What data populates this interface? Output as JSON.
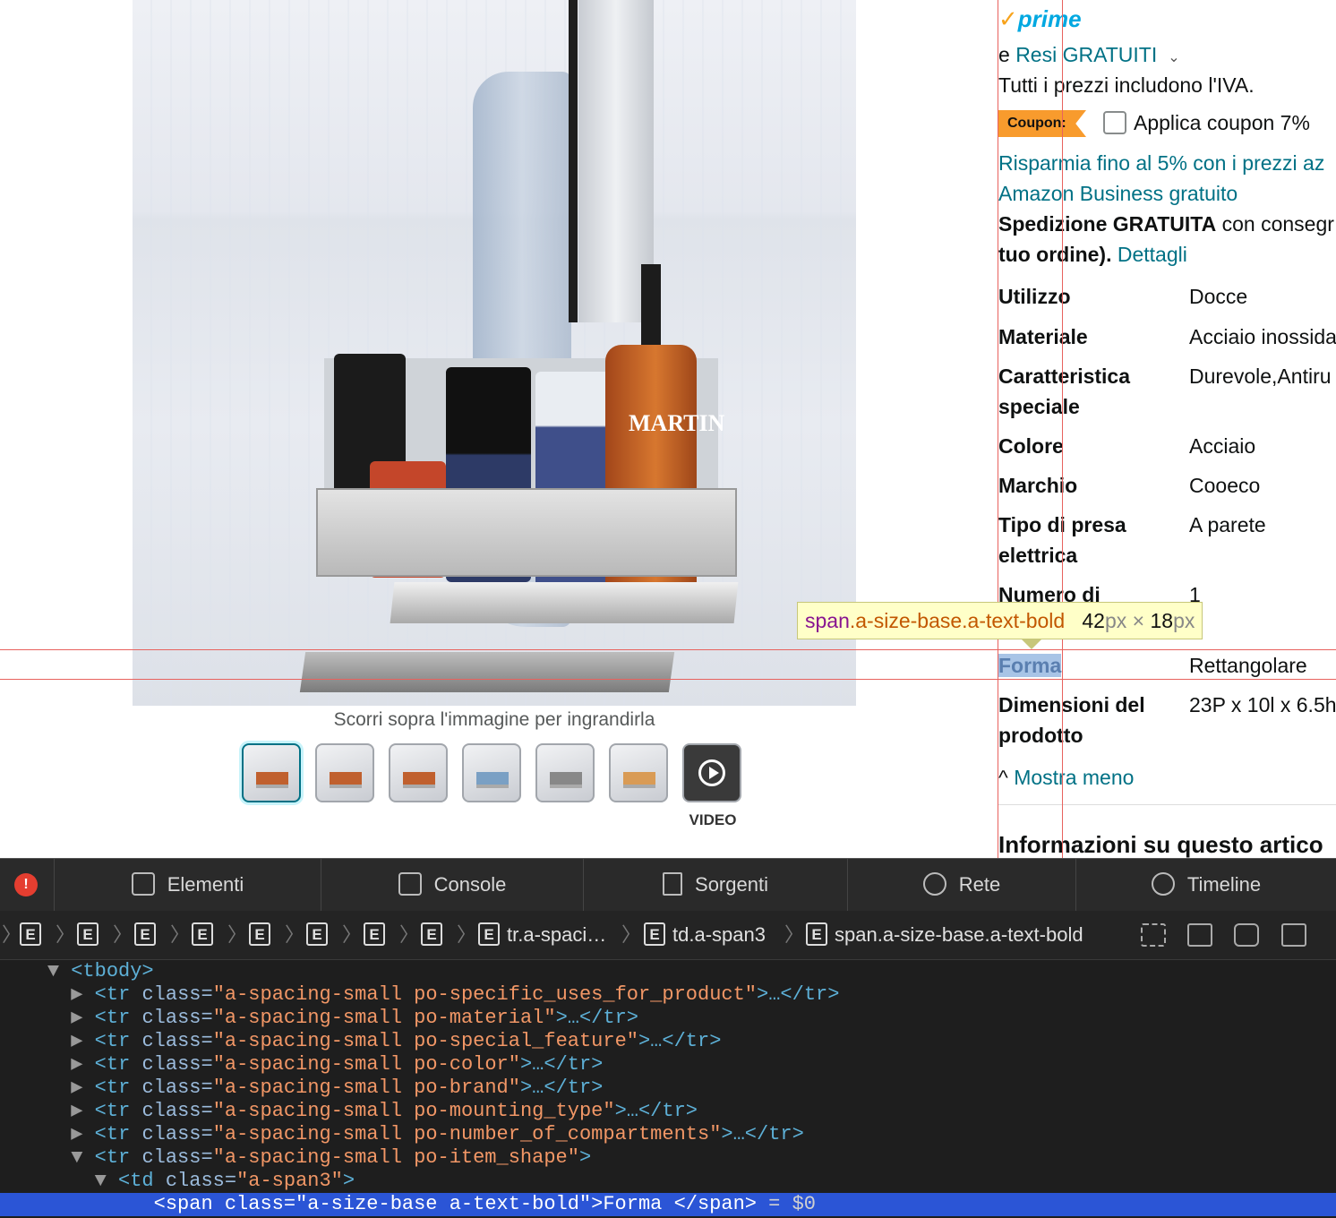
{
  "gallery": {
    "hover_hint": "Scorri sopra l'immagine per ingrandirla",
    "video_label": "VIDEO",
    "image_brand_text": "MARTIN",
    "thumbnail_count": 7
  },
  "offer": {
    "prime_label": "prime",
    "returns_prefix": "e",
    "returns_link": "Resi GRATUITI",
    "vat_note": "Tutti i prezzi includono l'IVA.",
    "coupon_badge": "Coupon:",
    "coupon_text": "Applica coupon 7%",
    "business_line1": "Risparmia fino al 5% con i prezzi az",
    "business_line2": "Amazon Business gratuito",
    "shipping_bold": "Spedizione GRATUITA",
    "shipping_rest": " con consegr",
    "shipping_line2_bold": "tuo ordine).",
    "details_link": "Dettagli"
  },
  "specs": [
    {
      "label": "Utilizzo",
      "value": "Docce"
    },
    {
      "label": "Materiale",
      "value": "Acciaio inossida"
    },
    {
      "label": "Caratteristica speciale",
      "value": "Durevole,Antiru"
    },
    {
      "label": "Colore",
      "value": "Acciaio"
    },
    {
      "label": "Marchio",
      "value": "Cooeco"
    },
    {
      "label": "Tipo di presa elettrica",
      "value": "A parete"
    },
    {
      "label": "Numero di",
      "value": "1"
    },
    {
      "label": "Forma",
      "value": "Rettangolare"
    },
    {
      "label": "Dimensioni del prodotto",
      "value": "23P x 10l x 6.5h"
    }
  ],
  "show_less": "Mostra meno",
  "info_heading": "Informazioni su questo artico",
  "inspector_tooltip": {
    "tag": "span",
    "classes": ".a-size-base.a-text-bold",
    "width": "42",
    "height": "18",
    "unit": "px",
    "times": "×"
  },
  "devtools": {
    "tabs": [
      "Elementi",
      "Console",
      "Sorgenti",
      "Rete",
      "Timeline"
    ],
    "error_glyph": "!",
    "breadcrumbs": [
      "",
      "",
      "",
      "",
      "",
      "",
      "",
      "",
      "tr.a-spaci…",
      "td.a-span3",
      "span.a-size-base.a-text-bold"
    ],
    "crumb_badge": "E",
    "dom_lines": [
      {
        "indent": 2,
        "tri": "▼",
        "open": "<tbody>",
        "cls": "",
        "tail": ""
      },
      {
        "indent": 3,
        "tri": "▶",
        "open": "<tr ",
        "attr": "class=",
        "cls": "\"a-spacing-small po-specific_uses_for_product\"",
        "tail": ">…</tr>"
      },
      {
        "indent": 3,
        "tri": "▶",
        "open": "<tr ",
        "attr": "class=",
        "cls": "\"a-spacing-small po-material\"",
        "tail": ">…</tr>"
      },
      {
        "indent": 3,
        "tri": "▶",
        "open": "<tr ",
        "attr": "class=",
        "cls": "\"a-spacing-small po-special_feature\"",
        "tail": ">…</tr>"
      },
      {
        "indent": 3,
        "tri": "▶",
        "open": "<tr ",
        "attr": "class=",
        "cls": "\"a-spacing-small po-color\"",
        "tail": ">…</tr>"
      },
      {
        "indent": 3,
        "tri": "▶",
        "open": "<tr ",
        "attr": "class=",
        "cls": "\"a-spacing-small po-brand\"",
        "tail": ">…</tr>"
      },
      {
        "indent": 3,
        "tri": "▶",
        "open": "<tr ",
        "attr": "class=",
        "cls": "\"a-spacing-small po-mounting_type\"",
        "tail": ">…</tr>"
      },
      {
        "indent": 3,
        "tri": "▶",
        "open": "<tr ",
        "attr": "class=",
        "cls": "\"a-spacing-small po-number_of_compartments\"",
        "tail": ">…</tr>"
      },
      {
        "indent": 3,
        "tri": "▼",
        "open": "<tr ",
        "attr": "class=",
        "cls": "\"a-spacing-small po-item_shape\"",
        "tail": ">"
      },
      {
        "indent": 4,
        "tri": "▼",
        "open": "<td ",
        "attr": "class=",
        "cls": "\"a-span3\"",
        "tail": ">"
      },
      {
        "indent": 6,
        "tri": "",
        "open": "<span ",
        "attr": "class=",
        "cls": "\"a-size-base a-text-bold\"",
        "tail": ">",
        "text": "Forma ",
        "close": "</span>",
        "eq": " = $0",
        "selected": true
      }
    ]
  },
  "colors": {
    "link": "#007185",
    "coupon_badge": "#f89b2d",
    "devtools_bg": "#1e1e1e",
    "selection": "#2b55d6",
    "guide_line": "#e8625e"
  }
}
